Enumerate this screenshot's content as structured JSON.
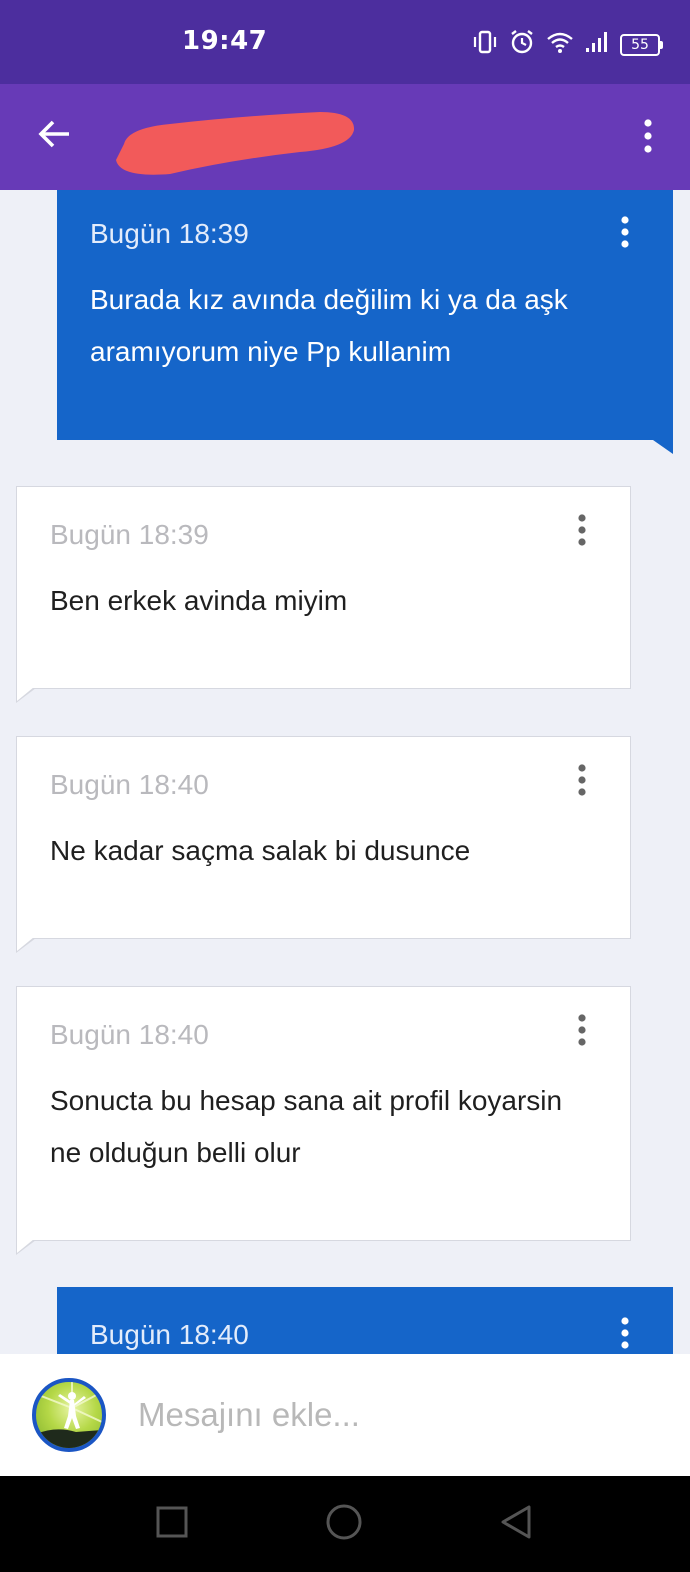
{
  "status_bar": {
    "time": "19:47",
    "battery": "55",
    "icons": [
      "vibrate-icon",
      "alarm-icon",
      "wifi-icon",
      "signal-icon",
      "battery-icon"
    ]
  },
  "app_bar": {
    "title": "",
    "title_redacted": true,
    "back_icon": "arrow-left-icon",
    "menu_icon": "more-vertical-icon"
  },
  "messages": [
    {
      "direction": "sent",
      "time": "Bugün 18:39",
      "text": "Burada kız avında değilim ki ya da aşk aramıyorum niye Pp kullanim"
    },
    {
      "direction": "received",
      "time": "Bugün 18:39",
      "text": "Ben erkek avinda miyim"
    },
    {
      "direction": "received",
      "time": "Bugün 18:40",
      "text": "Ne kadar saçma salak bi dusunce"
    },
    {
      "direction": "received",
      "time": "Bugün 18:40",
      "text": "Sonucta bu hesap sana ait profil koyarsin ne olduğun belli olur"
    },
    {
      "direction": "sent",
      "time": "Bugün 18:40",
      "text": ""
    }
  ],
  "composer": {
    "placeholder": "Mesajını ekle..."
  },
  "colors": {
    "status_bar": "#4c2e9e",
    "app_bar": "#673ab7",
    "sent_bubble": "#1565c9",
    "received_bubble": "#ffffff",
    "background": "#eef0f7"
  }
}
